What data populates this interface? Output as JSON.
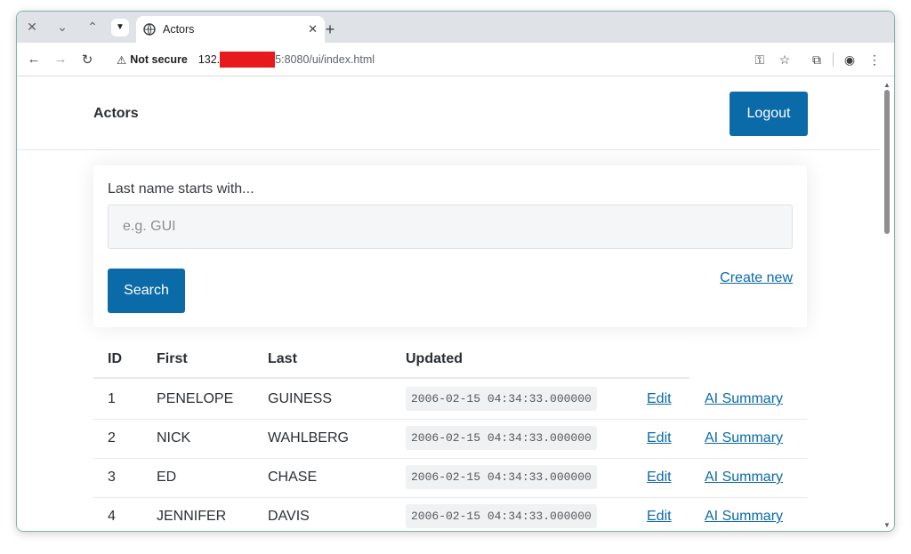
{
  "browser": {
    "tab_title": "Actors",
    "security_label": "Not secure",
    "url_host_prefix": "132.",
    "url_rest": "5:8080/ui/index.html"
  },
  "page": {
    "title": "Actors",
    "logout_label": "Logout"
  },
  "search": {
    "label": "Last name starts with...",
    "placeholder": "e.g. GUI",
    "button_label": "Search",
    "create_link": "Create new"
  },
  "table": {
    "headers": {
      "id": "ID",
      "first": "First",
      "last": "Last",
      "updated": "Updated"
    },
    "rows": [
      {
        "id": "1",
        "first": "PENELOPE",
        "last": "GUINESS",
        "updated": "2006-02-15 04:34:33.000000",
        "edit": "Edit",
        "ai": "AI Summary"
      },
      {
        "id": "2",
        "first": "NICK",
        "last": "WAHLBERG",
        "updated": "2006-02-15 04:34:33.000000",
        "edit": "Edit",
        "ai": "AI Summary"
      },
      {
        "id": "3",
        "first": "ED",
        "last": "CHASE",
        "updated": "2006-02-15 04:34:33.000000",
        "edit": "Edit",
        "ai": "AI Summary"
      },
      {
        "id": "4",
        "first": "JENNIFER",
        "last": "DAVIS",
        "updated": "2006-02-15 04:34:33.000000",
        "edit": "Edit",
        "ai": "AI Summary"
      }
    ]
  },
  "colors": {
    "primary": "#0b6aa8",
    "redaction": "#e8191d"
  }
}
